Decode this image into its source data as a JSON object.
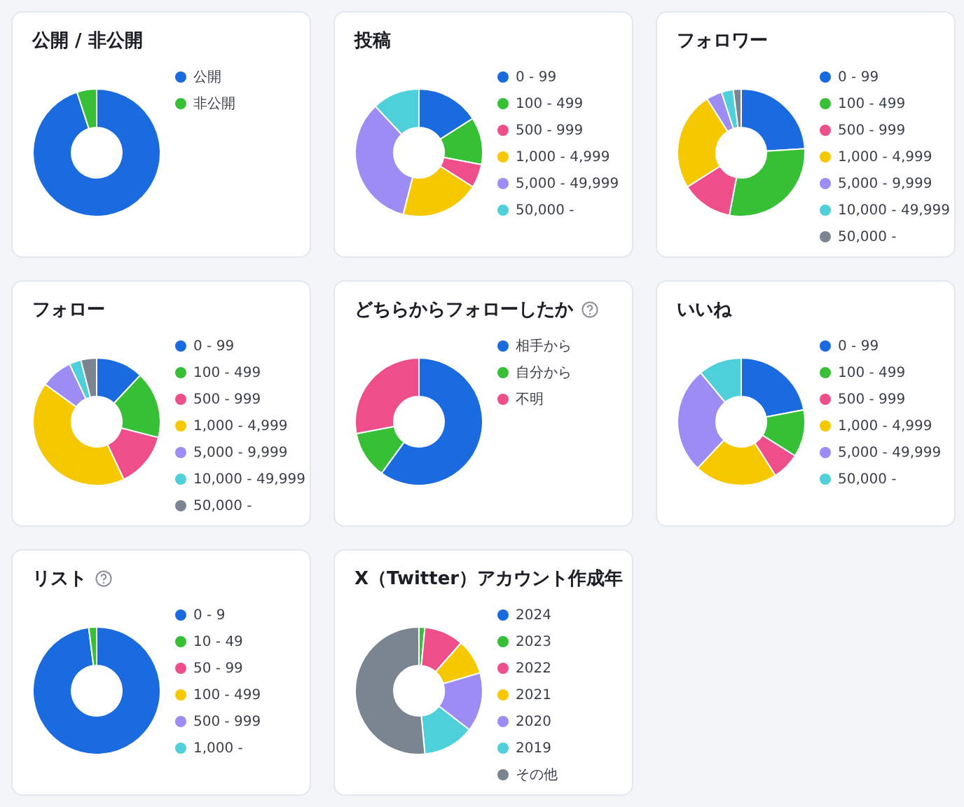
{
  "cards": [
    {
      "title": "公開 / 非公開",
      "help": false,
      "legend": [
        {
          "label": "公開",
          "color": "#1a6ae0"
        },
        {
          "label": "非公開",
          "color": "#37bf35"
        }
      ]
    },
    {
      "title": "投稿",
      "help": false,
      "legend": [
        {
          "label": "0 - 99",
          "color": "#1a6ae0"
        },
        {
          "label": "100 - 499",
          "color": "#37bf35"
        },
        {
          "label": "500 - 999",
          "color": "#ee4f8b"
        },
        {
          "label": "1,000 - 4,999",
          "color": "#f5c800"
        },
        {
          "label": "5,000 - 49,999",
          "color": "#9c8cf4"
        },
        {
          "label": "50,000 -",
          "color": "#4dd0da"
        }
      ]
    },
    {
      "title": "フォロワー",
      "help": false,
      "legend": [
        {
          "label": "0 - 99",
          "color": "#1a6ae0"
        },
        {
          "label": "100 - 499",
          "color": "#37bf35"
        },
        {
          "label": "500 - 999",
          "color": "#ee4f8b"
        },
        {
          "label": "1,000 - 4,999",
          "color": "#f5c800"
        },
        {
          "label": "5,000 - 9,999",
          "color": "#9c8cf4"
        },
        {
          "label": "10,000 - 49,999",
          "color": "#4dd0da"
        },
        {
          "label": "50,000 -",
          "color": "#7a8591"
        }
      ]
    },
    {
      "title": "フォロー",
      "help": false,
      "legend": [
        {
          "label": "0 - 99",
          "color": "#1a6ae0"
        },
        {
          "label": "100 - 499",
          "color": "#37bf35"
        },
        {
          "label": "500 - 999",
          "color": "#ee4f8b"
        },
        {
          "label": "1,000 - 4,999",
          "color": "#f5c800"
        },
        {
          "label": "5,000 - 9,999",
          "color": "#9c8cf4"
        },
        {
          "label": "10,000 - 49,999",
          "color": "#4dd0da"
        },
        {
          "label": "50,000 -",
          "color": "#7a8591"
        }
      ]
    },
    {
      "title": "どちらからフォローしたか",
      "help": true,
      "legend": [
        {
          "label": "相手から",
          "color": "#1a6ae0"
        },
        {
          "label": "自分から",
          "color": "#37bf35"
        },
        {
          "label": "不明",
          "color": "#ee4f8b"
        }
      ]
    },
    {
      "title": "いいね",
      "help": false,
      "legend": [
        {
          "label": "0 - 99",
          "color": "#1a6ae0"
        },
        {
          "label": "100 - 499",
          "color": "#37bf35"
        },
        {
          "label": "500 - 999",
          "color": "#ee4f8b"
        },
        {
          "label": "1,000 - 4,999",
          "color": "#f5c800"
        },
        {
          "label": "5,000 - 49,999",
          "color": "#9c8cf4"
        },
        {
          "label": "50,000 -",
          "color": "#4dd0da"
        }
      ]
    },
    {
      "title": "リスト",
      "help": true,
      "legend": [
        {
          "label": "0 - 9",
          "color": "#1a6ae0"
        },
        {
          "label": "10 - 49",
          "color": "#37bf35"
        },
        {
          "label": "50 - 99",
          "color": "#ee4f8b"
        },
        {
          "label": "100 - 499",
          "color": "#f5c800"
        },
        {
          "label": "500 - 999",
          "color": "#9c8cf4"
        },
        {
          "label": "1,000 -",
          "color": "#4dd0da"
        }
      ]
    },
    {
      "title": "X（Twitter）アカウント作成年",
      "help": false,
      "legend": [
        {
          "label": "2024",
          "color": "#1a6ae0"
        },
        {
          "label": "2023",
          "color": "#37bf35"
        },
        {
          "label": "2022",
          "color": "#ee4f8b"
        },
        {
          "label": "2021",
          "color": "#f5c800"
        },
        {
          "label": "2020",
          "color": "#9c8cf4"
        },
        {
          "label": "2019",
          "color": "#4dd0da"
        },
        {
          "label": "その他",
          "color": "#7a8591"
        }
      ]
    }
  ]
}
